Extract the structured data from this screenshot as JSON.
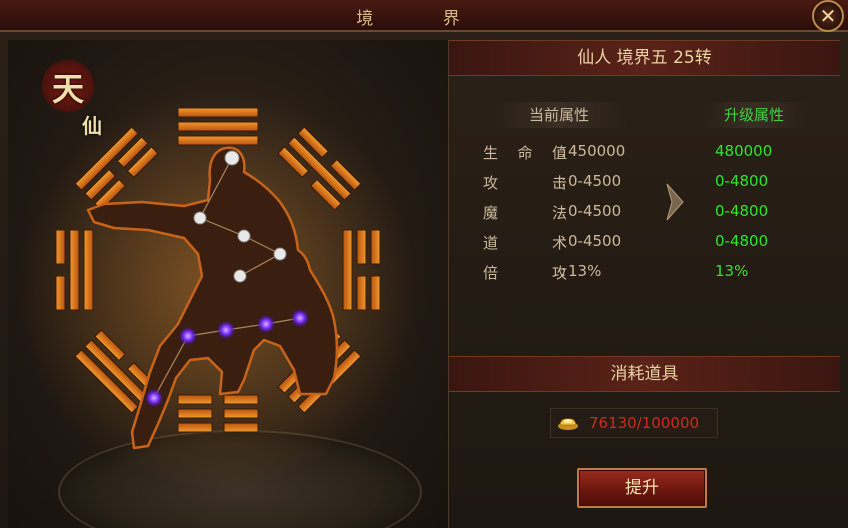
{
  "window": {
    "title": "境 界",
    "close_label": "✕"
  },
  "logo": {
    "char1": "天",
    "char2": "仙"
  },
  "header": {
    "level_text": "仙人 境界五 25转"
  },
  "columns": {
    "current": "当前属性",
    "upgrade": "升级属性"
  },
  "stats": [
    {
      "name": "生命值",
      "current": "450000",
      "upgrade": "480000"
    },
    {
      "name": "攻击",
      "current": "0-4500",
      "upgrade": "0-4800"
    },
    {
      "name": "魔法",
      "current": "0-4500",
      "upgrade": "0-4800"
    },
    {
      "name": "道术",
      "current": "0-4500",
      "upgrade": "0-4800"
    },
    {
      "name": "倍攻",
      "current": "13%",
      "upgrade": "13%"
    }
  ],
  "consume": {
    "title": "消耗道具",
    "icon": "gold-ingot-icon",
    "amount": "76130/100000"
  },
  "upgrade_button": {
    "label": "提升"
  },
  "colors": {
    "upgrade_green": "#2ee52e",
    "insufficient_red": "#d02a1f",
    "bagua_orange": "#e07a1a",
    "acupoint_purple": "#7a2cff"
  }
}
